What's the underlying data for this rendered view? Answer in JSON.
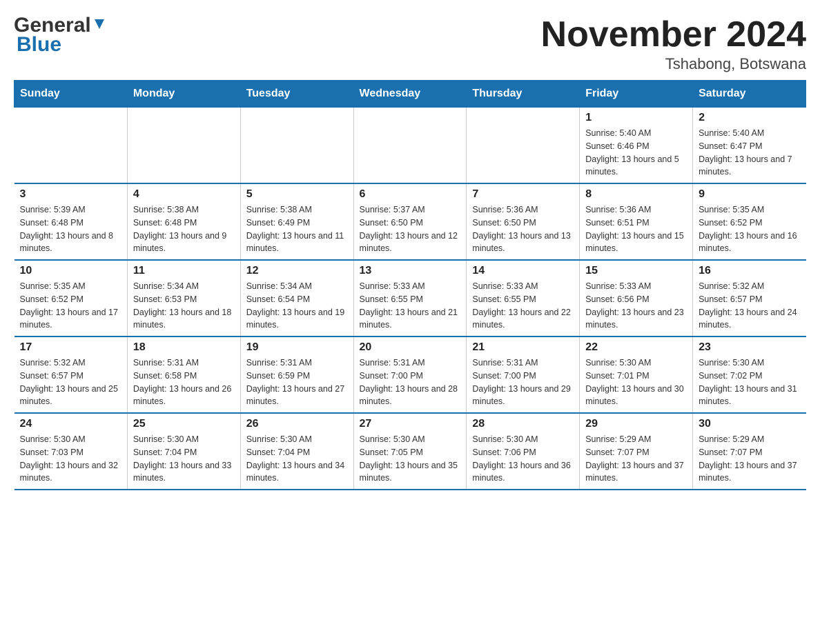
{
  "logo": {
    "general": "General",
    "triangle": "▼",
    "blue": "Blue"
  },
  "header": {
    "title": "November 2024",
    "location": "Tshabong, Botswana"
  },
  "days_of_week": [
    "Sunday",
    "Monday",
    "Tuesday",
    "Wednesday",
    "Thursday",
    "Friday",
    "Saturday"
  ],
  "weeks": [
    [
      {
        "num": "",
        "info": ""
      },
      {
        "num": "",
        "info": ""
      },
      {
        "num": "",
        "info": ""
      },
      {
        "num": "",
        "info": ""
      },
      {
        "num": "",
        "info": ""
      },
      {
        "num": "1",
        "info": "Sunrise: 5:40 AM\nSunset: 6:46 PM\nDaylight: 13 hours and 5 minutes."
      },
      {
        "num": "2",
        "info": "Sunrise: 5:40 AM\nSunset: 6:47 PM\nDaylight: 13 hours and 7 minutes."
      }
    ],
    [
      {
        "num": "3",
        "info": "Sunrise: 5:39 AM\nSunset: 6:48 PM\nDaylight: 13 hours and 8 minutes."
      },
      {
        "num": "4",
        "info": "Sunrise: 5:38 AM\nSunset: 6:48 PM\nDaylight: 13 hours and 9 minutes."
      },
      {
        "num": "5",
        "info": "Sunrise: 5:38 AM\nSunset: 6:49 PM\nDaylight: 13 hours and 11 minutes."
      },
      {
        "num": "6",
        "info": "Sunrise: 5:37 AM\nSunset: 6:50 PM\nDaylight: 13 hours and 12 minutes."
      },
      {
        "num": "7",
        "info": "Sunrise: 5:36 AM\nSunset: 6:50 PM\nDaylight: 13 hours and 13 minutes."
      },
      {
        "num": "8",
        "info": "Sunrise: 5:36 AM\nSunset: 6:51 PM\nDaylight: 13 hours and 15 minutes."
      },
      {
        "num": "9",
        "info": "Sunrise: 5:35 AM\nSunset: 6:52 PM\nDaylight: 13 hours and 16 minutes."
      }
    ],
    [
      {
        "num": "10",
        "info": "Sunrise: 5:35 AM\nSunset: 6:52 PM\nDaylight: 13 hours and 17 minutes."
      },
      {
        "num": "11",
        "info": "Sunrise: 5:34 AM\nSunset: 6:53 PM\nDaylight: 13 hours and 18 minutes."
      },
      {
        "num": "12",
        "info": "Sunrise: 5:34 AM\nSunset: 6:54 PM\nDaylight: 13 hours and 19 minutes."
      },
      {
        "num": "13",
        "info": "Sunrise: 5:33 AM\nSunset: 6:55 PM\nDaylight: 13 hours and 21 minutes."
      },
      {
        "num": "14",
        "info": "Sunrise: 5:33 AM\nSunset: 6:55 PM\nDaylight: 13 hours and 22 minutes."
      },
      {
        "num": "15",
        "info": "Sunrise: 5:33 AM\nSunset: 6:56 PM\nDaylight: 13 hours and 23 minutes."
      },
      {
        "num": "16",
        "info": "Sunrise: 5:32 AM\nSunset: 6:57 PM\nDaylight: 13 hours and 24 minutes."
      }
    ],
    [
      {
        "num": "17",
        "info": "Sunrise: 5:32 AM\nSunset: 6:57 PM\nDaylight: 13 hours and 25 minutes."
      },
      {
        "num": "18",
        "info": "Sunrise: 5:31 AM\nSunset: 6:58 PM\nDaylight: 13 hours and 26 minutes."
      },
      {
        "num": "19",
        "info": "Sunrise: 5:31 AM\nSunset: 6:59 PM\nDaylight: 13 hours and 27 minutes."
      },
      {
        "num": "20",
        "info": "Sunrise: 5:31 AM\nSunset: 7:00 PM\nDaylight: 13 hours and 28 minutes."
      },
      {
        "num": "21",
        "info": "Sunrise: 5:31 AM\nSunset: 7:00 PM\nDaylight: 13 hours and 29 minutes."
      },
      {
        "num": "22",
        "info": "Sunrise: 5:30 AM\nSunset: 7:01 PM\nDaylight: 13 hours and 30 minutes."
      },
      {
        "num": "23",
        "info": "Sunrise: 5:30 AM\nSunset: 7:02 PM\nDaylight: 13 hours and 31 minutes."
      }
    ],
    [
      {
        "num": "24",
        "info": "Sunrise: 5:30 AM\nSunset: 7:03 PM\nDaylight: 13 hours and 32 minutes."
      },
      {
        "num": "25",
        "info": "Sunrise: 5:30 AM\nSunset: 7:04 PM\nDaylight: 13 hours and 33 minutes."
      },
      {
        "num": "26",
        "info": "Sunrise: 5:30 AM\nSunset: 7:04 PM\nDaylight: 13 hours and 34 minutes."
      },
      {
        "num": "27",
        "info": "Sunrise: 5:30 AM\nSunset: 7:05 PM\nDaylight: 13 hours and 35 minutes."
      },
      {
        "num": "28",
        "info": "Sunrise: 5:30 AM\nSunset: 7:06 PM\nDaylight: 13 hours and 36 minutes."
      },
      {
        "num": "29",
        "info": "Sunrise: 5:29 AM\nSunset: 7:07 PM\nDaylight: 13 hours and 37 minutes."
      },
      {
        "num": "30",
        "info": "Sunrise: 5:29 AM\nSunset: 7:07 PM\nDaylight: 13 hours and 37 minutes."
      }
    ]
  ]
}
